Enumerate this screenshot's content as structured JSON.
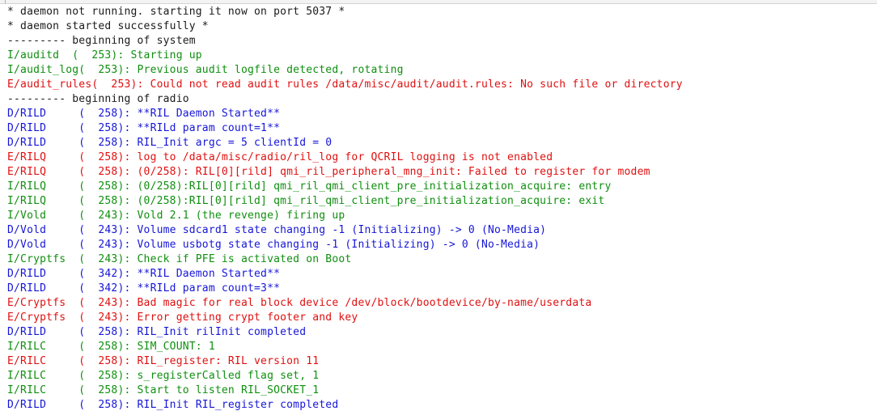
{
  "colors": {
    "plain": "#1a1a1a",
    "info": "#0f8f0f",
    "debug": "#1616d8",
    "error": "#e01010"
  },
  "log_lines": [
    {
      "text": "* daemon not running. starting it now on port 5037 *",
      "level": "plain"
    },
    {
      "text": "* daemon started successfully *",
      "level": "plain"
    },
    {
      "text": "--------- beginning of system",
      "level": "plain"
    },
    {
      "text": "I/auditd  (  253): Starting up",
      "level": "info"
    },
    {
      "text": "I/audit_log(  253): Previous audit logfile detected, rotating",
      "level": "info"
    },
    {
      "text": "E/audit_rules(  253): Could not read audit rules /data/misc/audit/audit.rules: No such file or directory",
      "level": "error"
    },
    {
      "text": "--------- beginning of radio",
      "level": "plain"
    },
    {
      "text": "D/RILD     (  258): **RIL Daemon Started**",
      "level": "debug"
    },
    {
      "text": "D/RILD     (  258): **RILd param count=1**",
      "level": "debug"
    },
    {
      "text": "D/RILD     (  258): RIL_Init argc = 5 clientId = 0",
      "level": "debug"
    },
    {
      "text": "E/RILQ     (  258): log to /data/misc/radio/ril_log for QCRIL logging is not enabled",
      "level": "error"
    },
    {
      "text": "E/RILQ     (  258): (0/258): RIL[0][rild] qmi_ril_peripheral_mng_init: Failed to register for modem",
      "level": "error"
    },
    {
      "text": "I/RILQ     (  258): (0/258):RIL[0][rild] qmi_ril_qmi_client_pre_initialization_acquire: entry",
      "level": "info"
    },
    {
      "text": "I/RILQ     (  258): (0/258):RIL[0][rild] qmi_ril_qmi_client_pre_initialization_acquire: exit",
      "level": "info"
    },
    {
      "text": "I/Vold     (  243): Vold 2.1 (the revenge) firing up",
      "level": "info"
    },
    {
      "text": "D/Vold     (  243): Volume sdcard1 state changing -1 (Initializing) -> 0 (No-Media)",
      "level": "debug"
    },
    {
      "text": "D/Vold     (  243): Volume usbotg state changing -1 (Initializing) -> 0 (No-Media)",
      "level": "debug"
    },
    {
      "text": "I/Cryptfs  (  243): Check if PFE is activated on Boot",
      "level": "info"
    },
    {
      "text": "D/RILD     (  342): **RIL Daemon Started**",
      "level": "debug"
    },
    {
      "text": "D/RILD     (  342): **RILd param count=3**",
      "level": "debug"
    },
    {
      "text": "E/Cryptfs  (  243): Bad magic for real block device /dev/block/bootdevice/by-name/userdata",
      "level": "error"
    },
    {
      "text": "E/Cryptfs  (  243): Error getting crypt footer and key",
      "level": "error"
    },
    {
      "text": "D/RILD     (  258): RIL_Init rilInit completed",
      "level": "debug"
    },
    {
      "text": "I/RILC     (  258): SIM_COUNT: 1",
      "level": "info"
    },
    {
      "text": "E/RILC     (  258): RIL_register: RIL version 11",
      "level": "error"
    },
    {
      "text": "I/RILC     (  258): s_registerCalled flag set, 1",
      "level": "info"
    },
    {
      "text": "I/RILC     (  258): Start to listen RIL_SOCKET_1",
      "level": "info"
    },
    {
      "text": "D/RILD     (  258): RIL_Init RIL_register completed",
      "level": "debug"
    }
  ]
}
